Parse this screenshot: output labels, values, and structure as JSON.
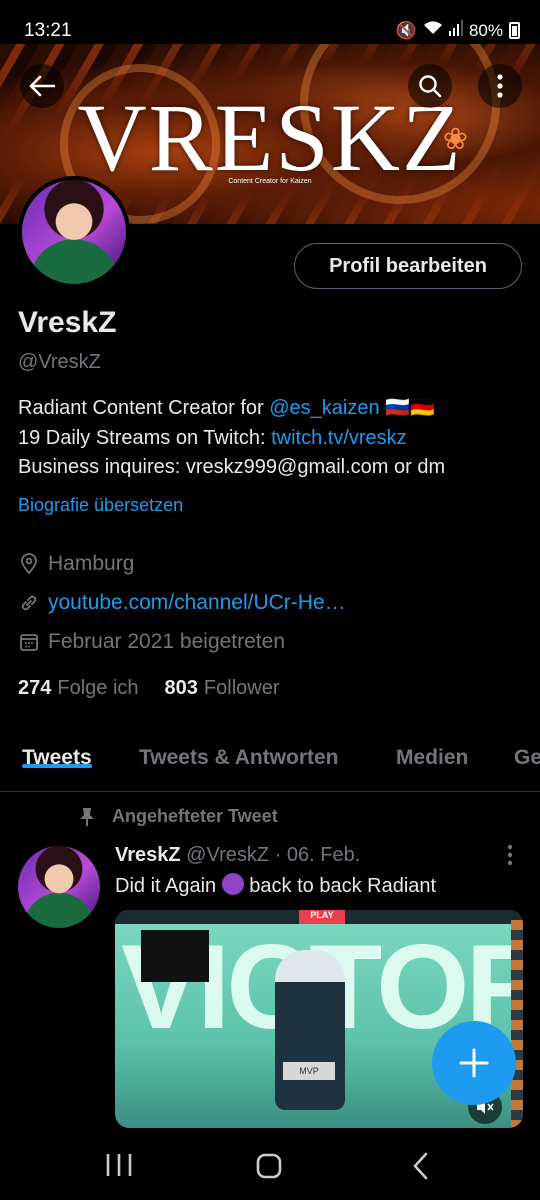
{
  "status_bar": {
    "time": "13:21",
    "battery": "80%"
  },
  "banner": {
    "title": "VRESKZ",
    "subtitle": "Content Creator for Kaizen"
  },
  "profile": {
    "edit_button": "Profil bearbeiten",
    "name": "VreskZ",
    "handle": "@VreskZ",
    "bio": {
      "line1_text": "Radiant Content Creator for ",
      "line1_link": "@es_kaizen",
      "line1_flags": "🇷🇺🇩🇪",
      "line2_text": "19 Daily Streams on Twitch: ",
      "line2_link": "twitch.tv/vreskz",
      "line3_text": "Business inquires: vreskz999@gmail.com or dm"
    },
    "translate_bio": "Biografie übersetzen",
    "location": "Hamburg",
    "website": "youtube.com/channel/UCr-He…",
    "joined": "Februar 2021 beigetreten",
    "following_count": "274",
    "following_label": "Folge ich",
    "followers_count": "803",
    "followers_label": "Follower"
  },
  "tabs": [
    {
      "label": "Tweets",
      "active": true
    },
    {
      "label": "Tweets & Antworten",
      "active": false
    },
    {
      "label": "Medien",
      "active": false
    },
    {
      "label": "Ge",
      "active": false
    }
  ],
  "pinned_tweet": {
    "pinned_label": "Angehefteter Tweet",
    "author_name": "VreskZ",
    "author_handle": "@VreskZ",
    "date_sep": "·",
    "date": "06. Feb.",
    "text_before": "Did it Again ",
    "text_after": " back to back  Radiant",
    "media": {
      "top_label": "PLAY",
      "headline": "VICTORY",
      "badge": "MVP"
    }
  },
  "colors": {
    "accent": "#1d9bf0",
    "secondary_text": "#71767b",
    "background": "#000000"
  }
}
